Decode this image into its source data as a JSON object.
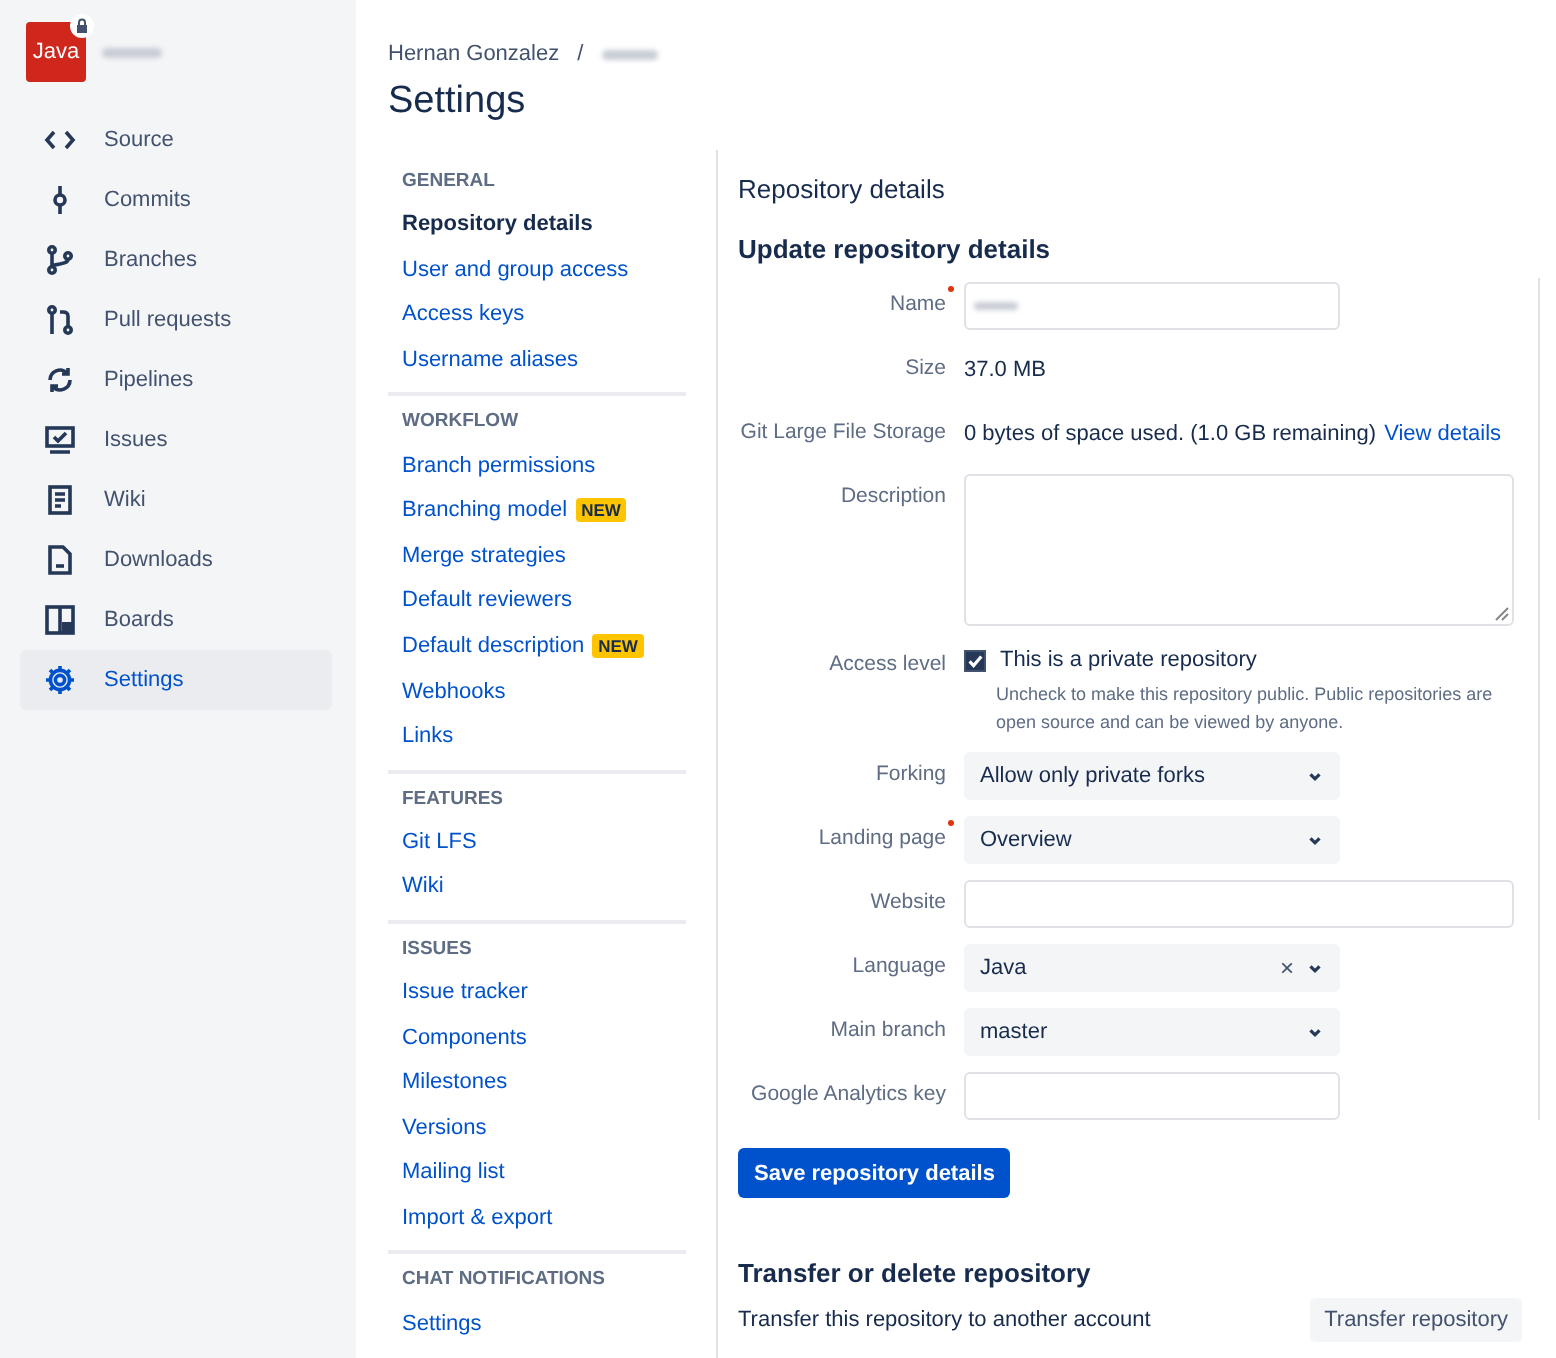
{
  "repo_badge": {
    "label": "Java",
    "locked": true
  },
  "sidebar": {
    "items": [
      {
        "label": "Source",
        "selected": false
      },
      {
        "label": "Commits",
        "selected": false
      },
      {
        "label": "Branches",
        "selected": false
      },
      {
        "label": "Pull requests",
        "selected": false
      },
      {
        "label": "Pipelines",
        "selected": false
      },
      {
        "label": "Issues",
        "selected": false
      },
      {
        "label": "Wiki",
        "selected": false
      },
      {
        "label": "Downloads",
        "selected": false
      },
      {
        "label": "Boards",
        "selected": false
      },
      {
        "label": "Settings",
        "selected": true
      }
    ]
  },
  "breadcrumb": {
    "owner": "Hernan Gonzalez",
    "separator": "/"
  },
  "page_title": "Settings",
  "settings_nav": [
    {
      "heading": "GENERAL",
      "items": [
        {
          "label": "Repository details",
          "selected": true
        },
        {
          "label": "User and group access",
          "selected": false
        },
        {
          "label": "Access keys",
          "selected": false
        },
        {
          "label": "Username aliases",
          "selected": false
        }
      ]
    },
    {
      "heading": "WORKFLOW",
      "items": [
        {
          "label": "Branch permissions",
          "selected": false
        },
        {
          "label": "Branching model",
          "selected": false,
          "badge": "NEW"
        },
        {
          "label": "Merge strategies",
          "selected": false
        },
        {
          "label": "Default reviewers",
          "selected": false
        },
        {
          "label": "Default description",
          "selected": false,
          "badge": "NEW"
        },
        {
          "label": "Webhooks",
          "selected": false
        },
        {
          "label": "Links",
          "selected": false
        }
      ]
    },
    {
      "heading": "FEATURES",
      "items": [
        {
          "label": "Git LFS",
          "selected": false
        },
        {
          "label": "Wiki",
          "selected": false
        }
      ]
    },
    {
      "heading": "ISSUES",
      "items": [
        {
          "label": "Issue tracker",
          "selected": false
        },
        {
          "label": "Components",
          "selected": false
        },
        {
          "label": "Milestones",
          "selected": false
        },
        {
          "label": "Versions",
          "selected": false
        },
        {
          "label": "Mailing list",
          "selected": false
        },
        {
          "label": "Import & export",
          "selected": false
        }
      ]
    },
    {
      "heading": "CHAT NOTIFICATIONS",
      "items": [
        {
          "label": "Settings",
          "selected": false
        }
      ]
    }
  ],
  "section_title": "Repository details",
  "form_title": "Update repository details",
  "fields": [
    {
      "label": "Name",
      "required": true,
      "kind": "short-input",
      "redacted": true
    },
    {
      "label": "Size",
      "required": false,
      "kind": "text",
      "value": "37.0 MB"
    },
    {
      "label": "Git Large File Storage",
      "required": false,
      "kind": "text-link",
      "value": "0 bytes of space used. (1.0 GB remaining)",
      "link": "View details"
    },
    {
      "label": "Description",
      "required": false,
      "kind": "textarea"
    },
    {
      "label": "Access level",
      "required": false,
      "kind": "checkbox",
      "value": "This is a private repository",
      "checked": true,
      "hint": "Uncheck to make this repository public. Public repositories are open source and can be viewed by anyone."
    },
    {
      "label": "Forking",
      "required": false,
      "kind": "select",
      "value": "Allow only private forks"
    },
    {
      "label": "Landing page",
      "required": true,
      "kind": "select",
      "value": "Overview"
    },
    {
      "label": "Website",
      "required": false,
      "kind": "wide-input",
      "redacted": false
    },
    {
      "label": "Language",
      "required": false,
      "kind": "clearable-select",
      "value": "Java",
      "clear": "×"
    },
    {
      "label": "Main branch",
      "required": false,
      "kind": "select",
      "value": "master"
    },
    {
      "label": "Google Analytics key",
      "required": false,
      "kind": "short-input",
      "redacted": false
    }
  ],
  "save_button": "Save repository details",
  "transfer": {
    "title": "Transfer or delete repository",
    "text": "Transfer this repository to another account",
    "button": "Transfer repository"
  }
}
